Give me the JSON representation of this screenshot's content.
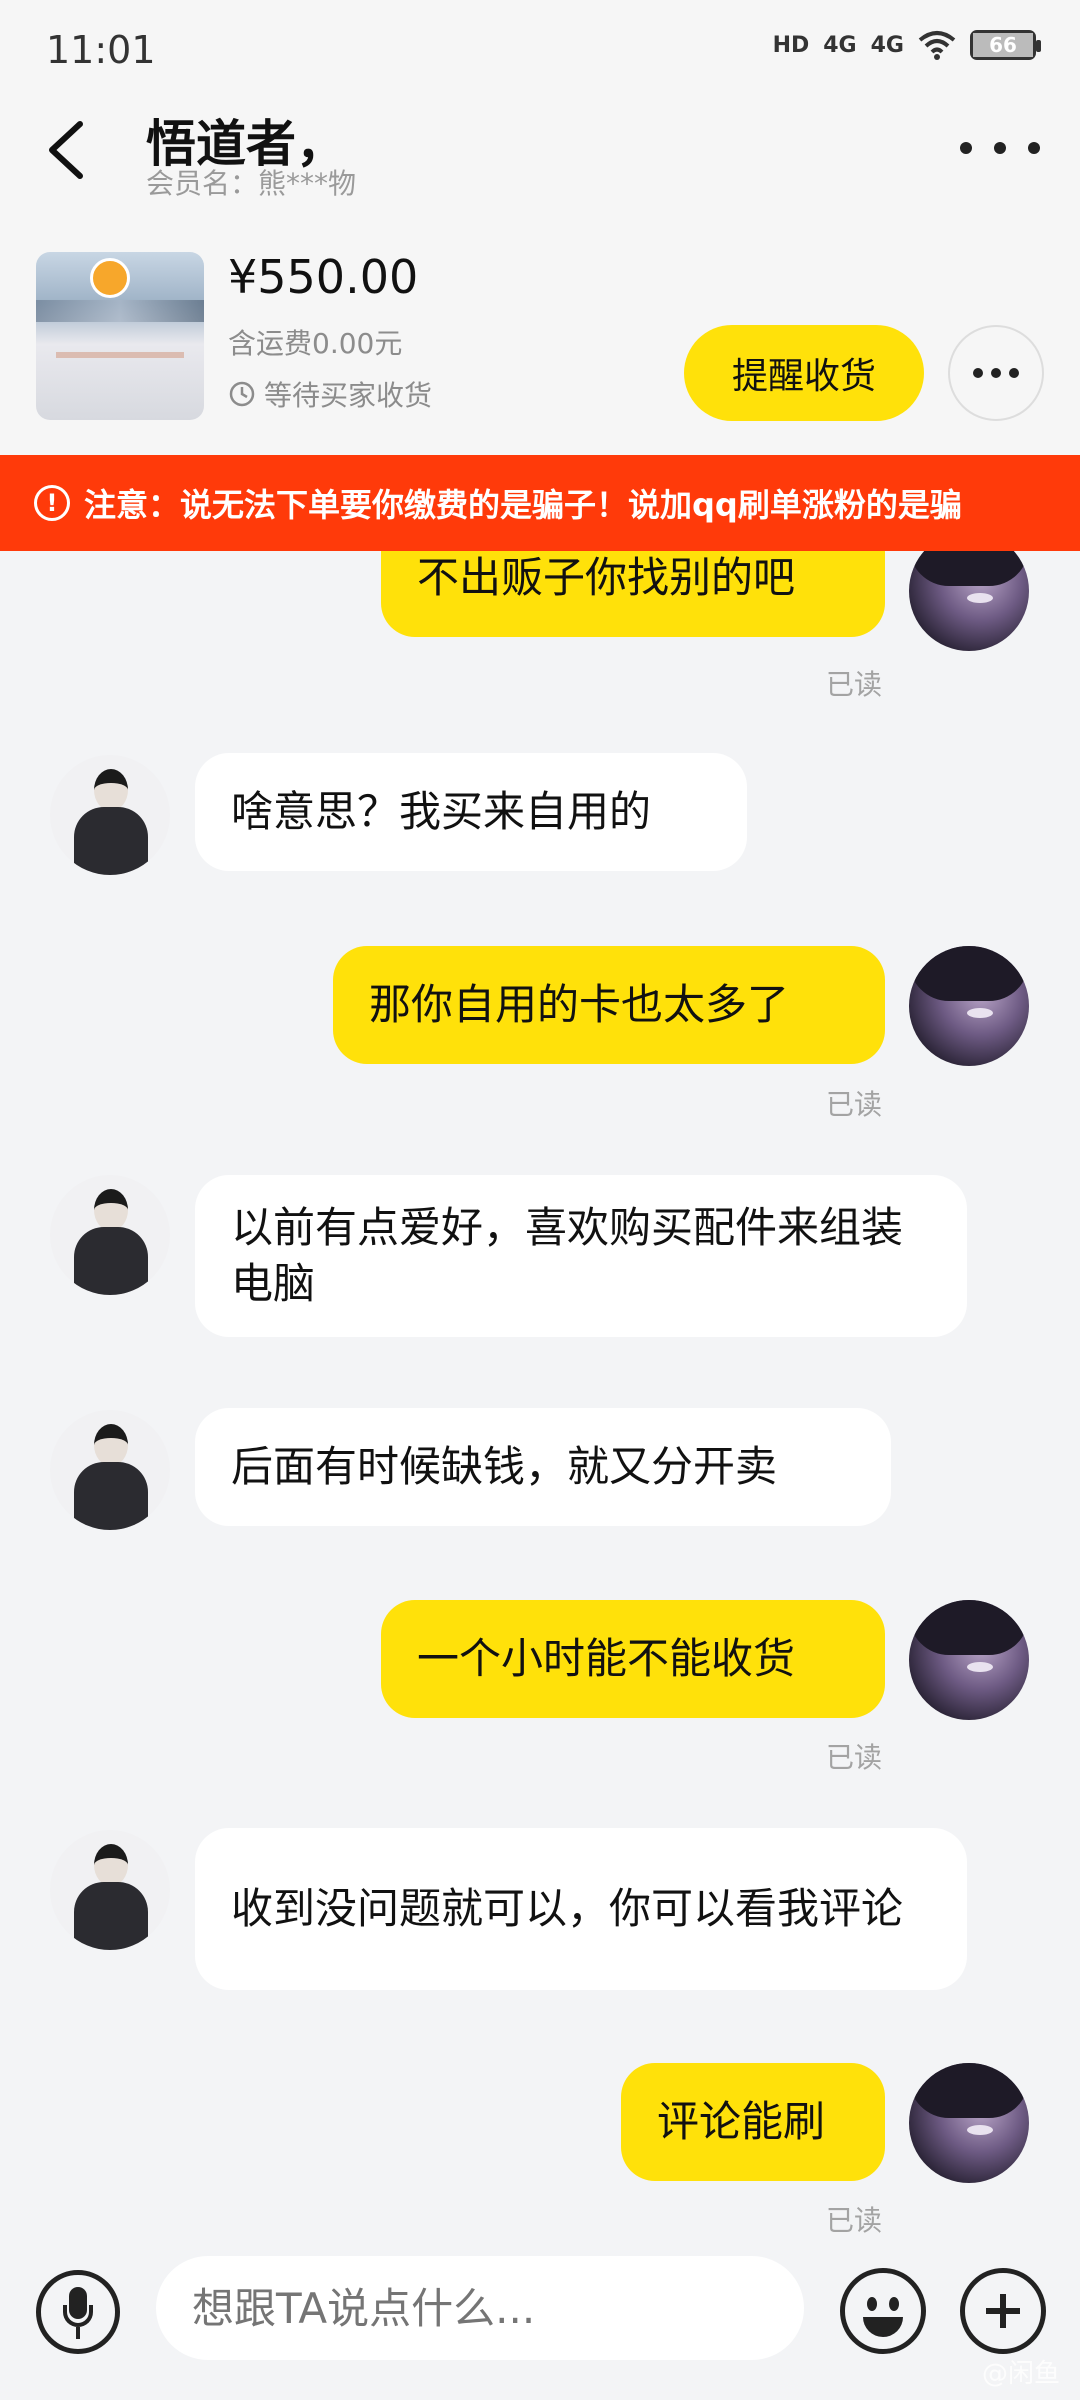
{
  "status_bar": {
    "time": "11:01",
    "hd": "HD",
    "net1": "4G",
    "net2": "4G",
    "battery": "66"
  },
  "header": {
    "title": "悟道者，",
    "subtitle": "会员名：熊***物"
  },
  "product": {
    "price": "¥550.00",
    "shipping": "含运费0.00元",
    "status": "等待买家收货",
    "remind_button": "提醒收货"
  },
  "warning": {
    "text": "注意：说无法下单要你缴费的是骗子！说加qq刷单涨粉的是骗"
  },
  "messages": [
    {
      "from": "me",
      "text": "不出贩子你找别的吧",
      "read": "已读"
    },
    {
      "from": "them",
      "text": "啥意思？我买来自用的"
    },
    {
      "from": "me",
      "text": "那你自用的卡也太多了",
      "read": "已读"
    },
    {
      "from": "them",
      "text": "以前有点爱好，喜欢购买配件来组装电脑"
    },
    {
      "from": "them",
      "text": "后面有时候缺钱，就又分开卖"
    },
    {
      "from": "me",
      "text": "一个小时能不能收货",
      "read": "已读"
    },
    {
      "from": "them",
      "text": "收到没问题就可以，你可以看我评论"
    },
    {
      "from": "me",
      "text": "评论能刷",
      "read": "已读"
    }
  ],
  "input": {
    "placeholder": "想跟TA说点什么..."
  },
  "watermark": "@闲鱼"
}
